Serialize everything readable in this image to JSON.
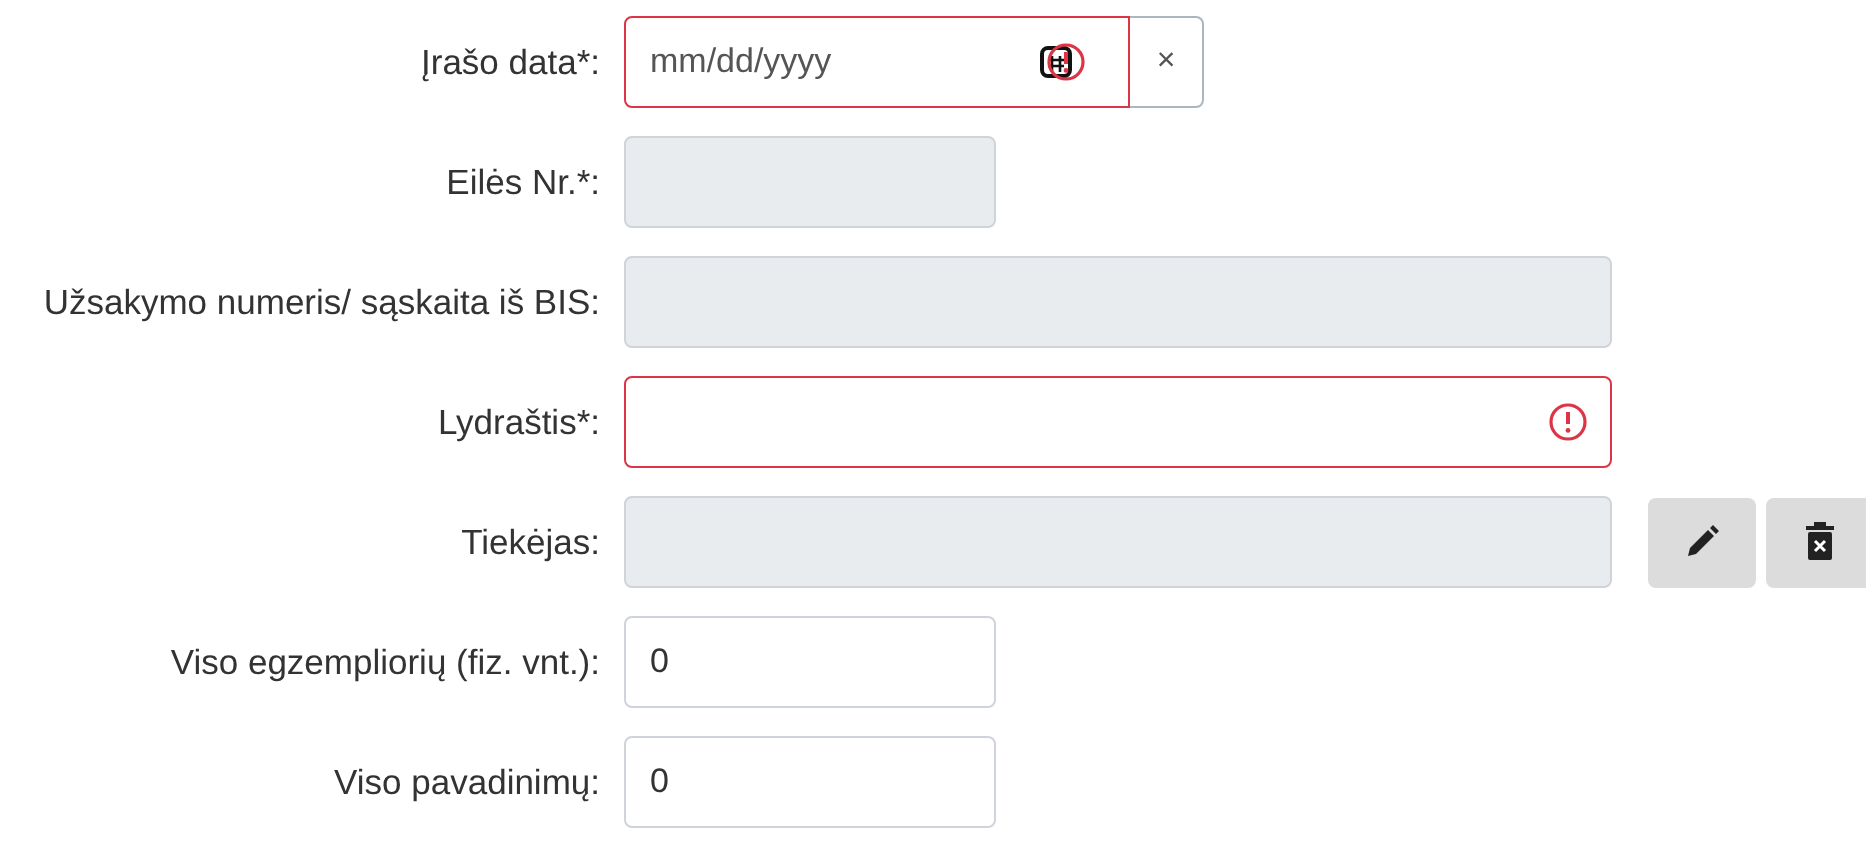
{
  "fields": [
    {
      "kind": "date",
      "label": "Įrašo data*:",
      "placeholder": "mm/dd/yyyy",
      "invalid": true,
      "disabled": false,
      "clear": "×"
    },
    {
      "kind": "number",
      "label": "Eilės Nr.*:",
      "invalid": false,
      "disabled": true
    },
    {
      "kind": "text",
      "label": "Užsakymo numeris/ sąskaita iš BIS:",
      "invalid": false,
      "disabled": true
    },
    {
      "kind": "text",
      "label": "Lydraštis*:",
      "invalid": true,
      "disabled": false
    },
    {
      "kind": "lookup",
      "label": "Tiekėjas:",
      "invalid": false,
      "disabled": true
    },
    {
      "kind": "number",
      "label": "Viso egzempliorių (fiz. vnt.):",
      "value": "0",
      "invalid": false,
      "disabled": false
    },
    {
      "kind": "number",
      "label": "Viso pavadinimų:",
      "value": "0",
      "invalid": false,
      "disabled": false
    }
  ]
}
